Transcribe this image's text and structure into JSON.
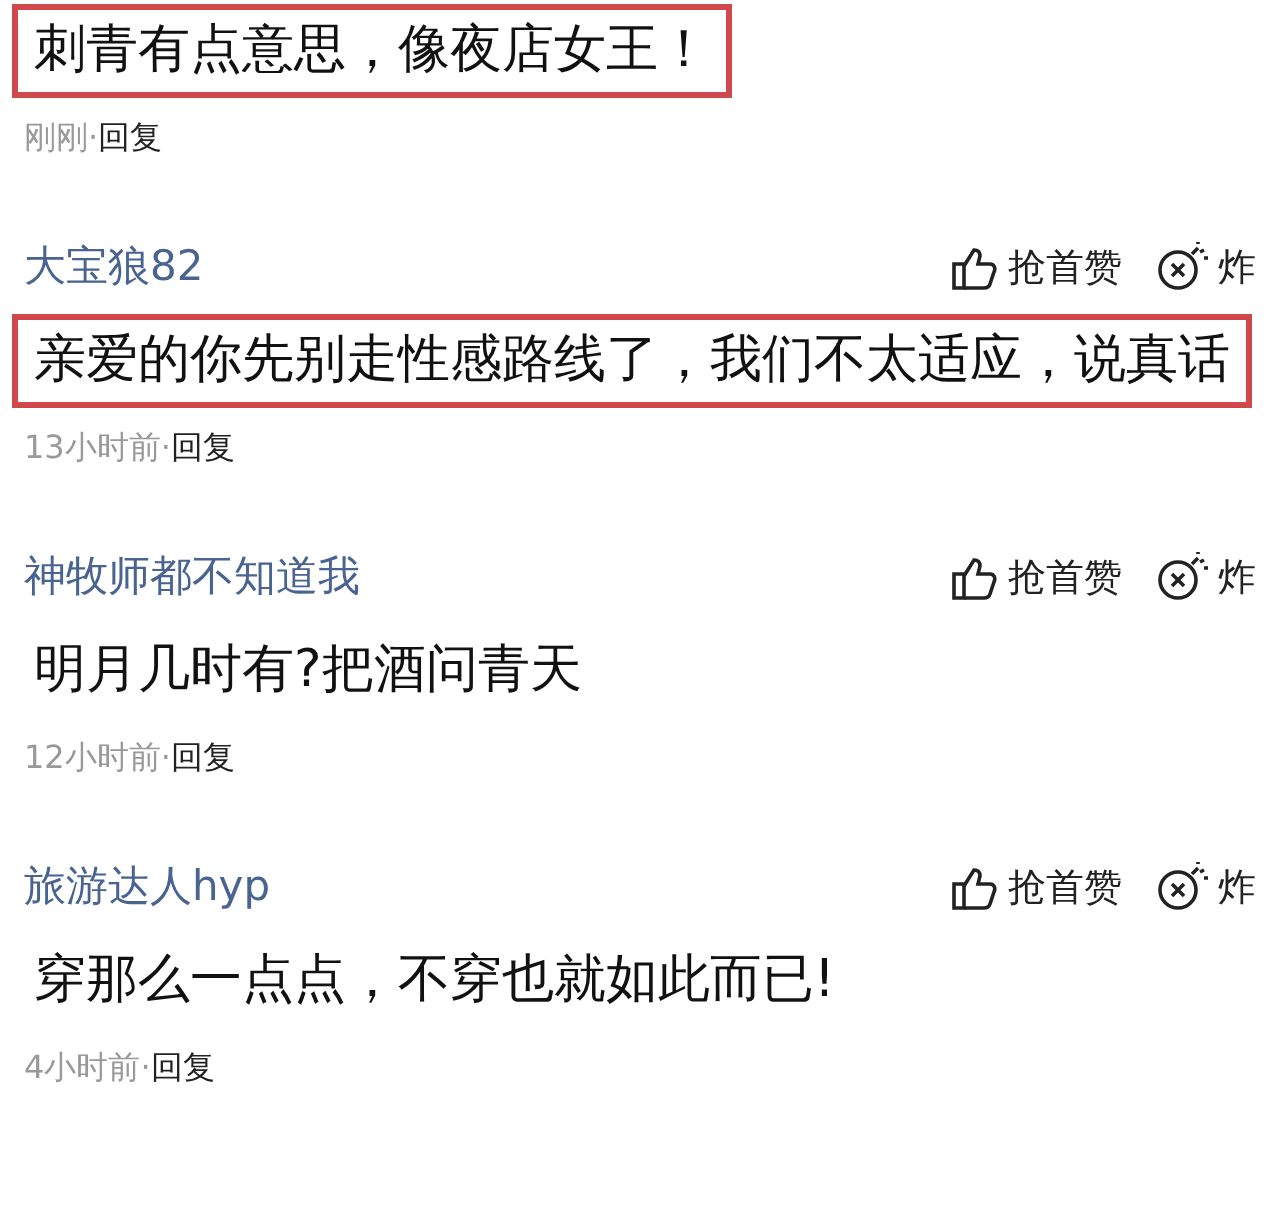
{
  "comments": [
    {
      "text": "刺青有点意思，像夜店女王！",
      "highlighted": true,
      "time": "刚刚",
      "separator": "·",
      "reply": "回复"
    },
    {
      "author": "大宝狼82",
      "like": "抢首赞",
      "bomb": "炸",
      "text": "亲爱的你先别走性感路线了，我们不太适应，说真话",
      "highlighted": true,
      "time": "13小时前",
      "separator": "·",
      "reply": "回复"
    },
    {
      "author": "神牧师都不知道我",
      "like": "抢首赞",
      "bomb": "炸",
      "text": "明月几时有?把酒问青天",
      "highlighted": false,
      "time": "12小时前",
      "separator": "·",
      "reply": "回复"
    },
    {
      "author": "旅游达人hyp",
      "like": "抢首赞",
      "bomb": "炸",
      "text": "穿那么一点点，不穿也就如此而已!",
      "highlighted": false,
      "time": "4小时前",
      "separator": "·",
      "reply": "回复"
    }
  ]
}
